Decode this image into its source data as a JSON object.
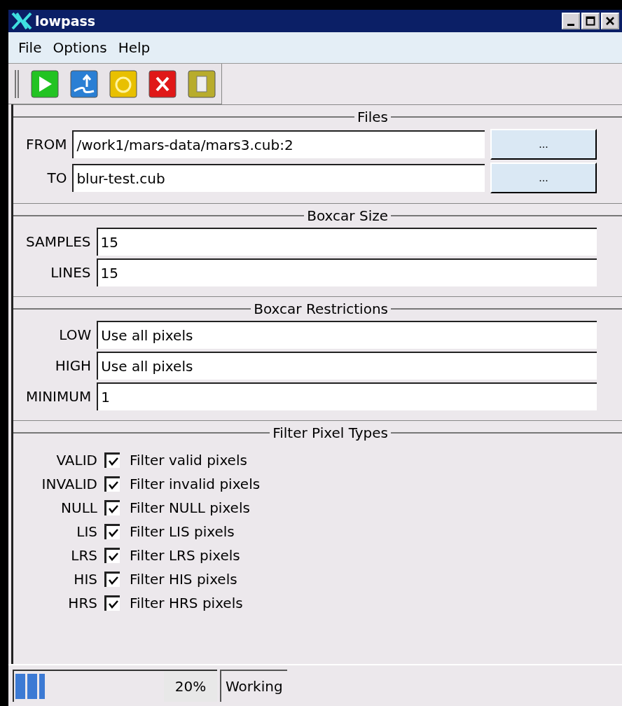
{
  "window": {
    "title": "lowpass"
  },
  "menu": [
    "File",
    "Options",
    "Help"
  ],
  "sections": [
    {
      "title": "Files",
      "kind": "fields",
      "fields": [
        {
          "label": "FROM",
          "value": "/work1/mars-data/mars3.cub:2",
          "button": "..."
        },
        {
          "label": "TO",
          "value": "blur-test.cub",
          "button": "..."
        }
      ]
    },
    {
      "title": "Boxcar Size",
      "kind": "fields",
      "fields": [
        {
          "label": "SAMPLES",
          "value": "15"
        },
        {
          "label": "LINES",
          "value": "15"
        }
      ]
    },
    {
      "title": "Boxcar Restrictions",
      "kind": "fields",
      "fields": [
        {
          "label": "LOW",
          "value": "Use all pixels"
        },
        {
          "label": "HIGH",
          "value": "Use all pixels"
        },
        {
          "label": "MINIMUM",
          "value": "1"
        }
      ]
    },
    {
      "title": "Filter Pixel Types",
      "kind": "checks",
      "checks": [
        {
          "label": "VALID",
          "text": "Filter valid pixels",
          "checked": true
        },
        {
          "label": "INVALID",
          "text": "Filter invalid pixels",
          "checked": true
        },
        {
          "label": "NULL",
          "text": "Filter NULL pixels",
          "checked": true
        },
        {
          "label": "LIS",
          "text": "Filter LIS pixels",
          "checked": true
        },
        {
          "label": "LRS",
          "text": "Filter LRS pixels",
          "checked": true
        },
        {
          "label": "HIS",
          "text": "Filter HIS pixels",
          "checked": true
        },
        {
          "label": "HRS",
          "text": "Filter HRS pixels",
          "checked": true
        }
      ]
    }
  ],
  "status_bar": {
    "level": 0.2,
    "percent": "20%",
    "message": "Working"
  }
}
